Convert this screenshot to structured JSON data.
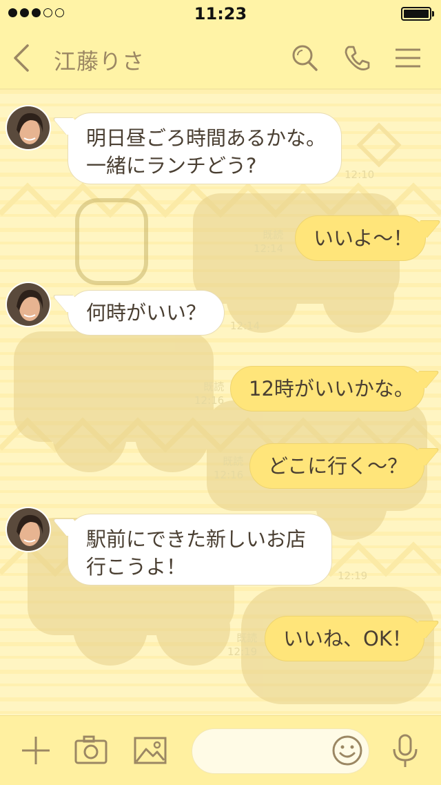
{
  "status": {
    "time": "11:23"
  },
  "header": {
    "title": "江藤りさ"
  },
  "messages": [
    {
      "side": "in",
      "text_lines": [
        "明日昼ごろ時間あるかな。",
        "一緒にランチどう?"
      ],
      "time": "12:10"
    },
    {
      "side": "out",
      "text": "いいよ～！",
      "read": "既読",
      "time": "12:14"
    },
    {
      "side": "in",
      "text": "何時がいい？",
      "time": "12:14"
    },
    {
      "side": "out",
      "text": "12時がいいかな。",
      "read": "既読",
      "time": "12:16"
    },
    {
      "side": "out",
      "text": "どこに行く～？",
      "read": "既読",
      "time": "12:16"
    },
    {
      "side": "in",
      "text_lines": [
        "駅前にできた新しいお店",
        "行こうよ！"
      ],
      "time": "12:19"
    },
    {
      "side": "out",
      "text": "いいね、OK！",
      "read": "既読",
      "time": "12:19"
    }
  ],
  "icons": {
    "back": "chevron-left-icon",
    "search": "search-icon",
    "call": "phone-icon",
    "menu": "menu-icon",
    "add": "plus-icon",
    "camera": "camera-icon",
    "image": "image-icon",
    "emoji": "smile-icon",
    "mic": "microphone-icon"
  },
  "colors": {
    "header_bg": "#fff3a6",
    "outgoing_bubble": "#ffe57a",
    "incoming_bubble": "#ffffff",
    "icon": "#9b8763"
  }
}
